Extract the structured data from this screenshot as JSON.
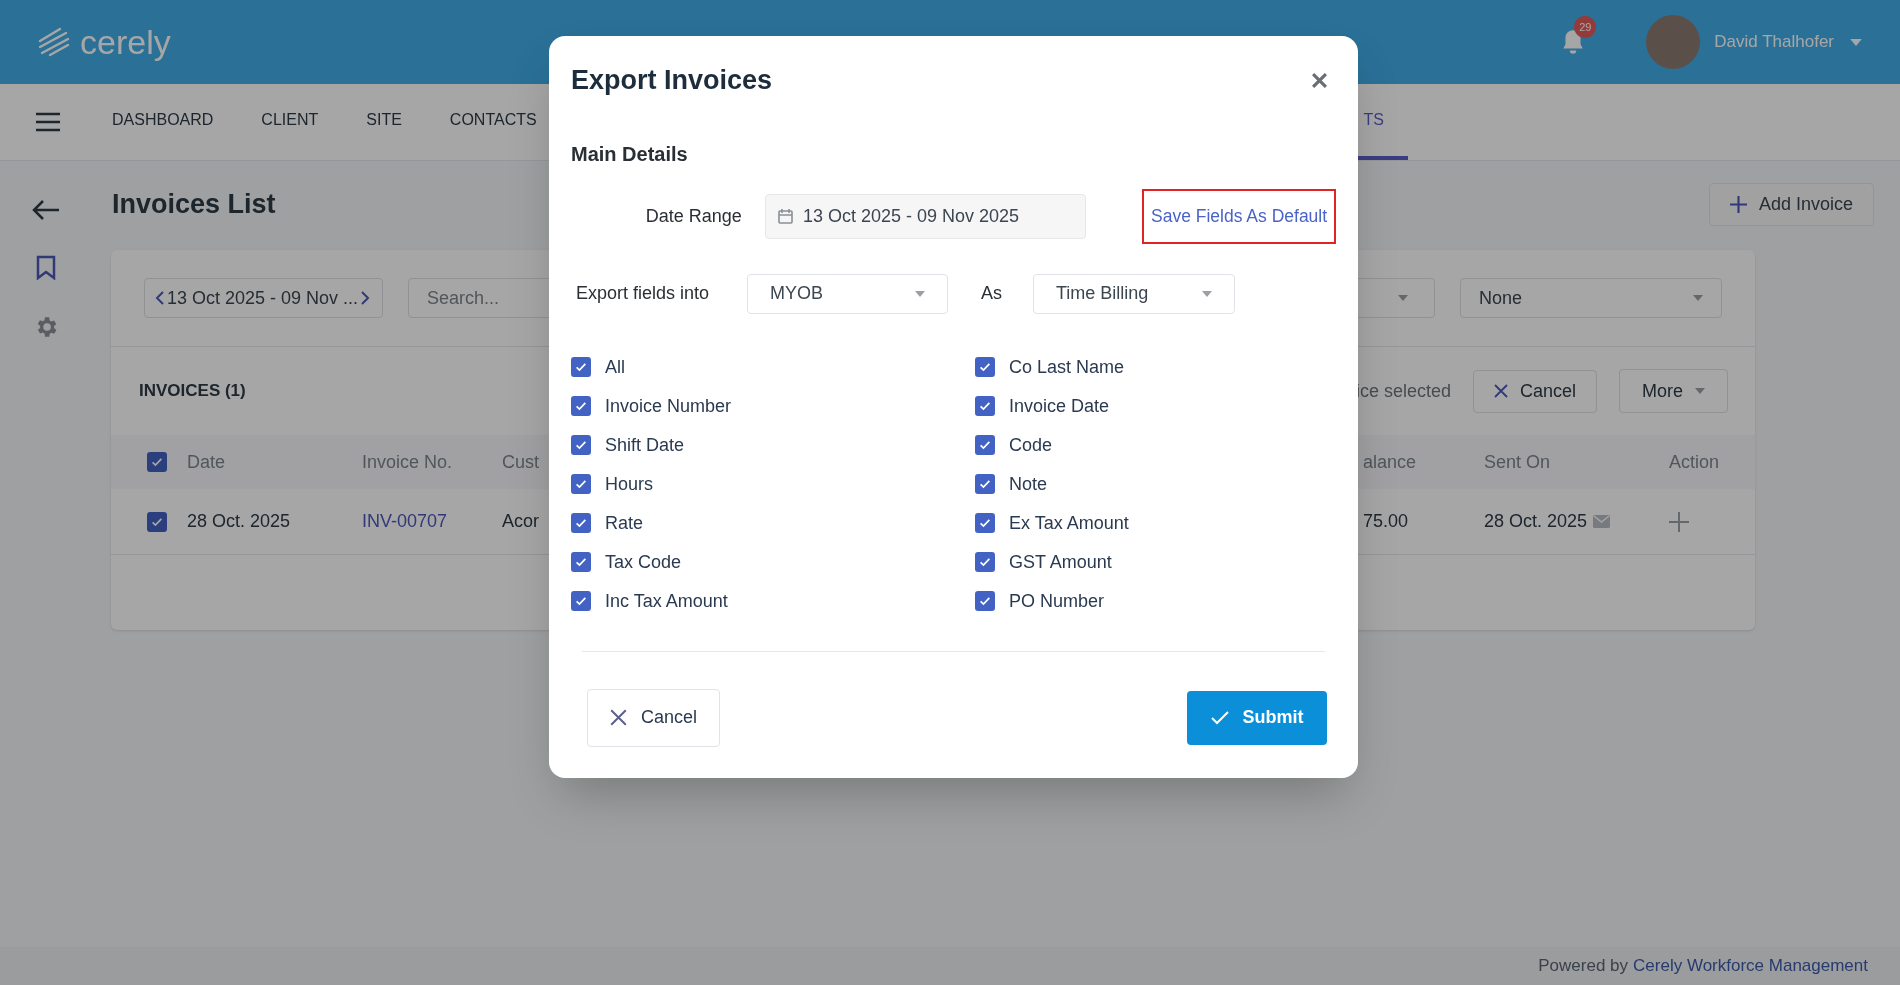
{
  "header": {
    "logo": "cerely",
    "notifications_badge": "29",
    "user_name": "David Thalhofer"
  },
  "nav": {
    "tabs": [
      {
        "label": "DASHBOARD",
        "selected": false
      },
      {
        "label": "CLIENT",
        "selected": false
      },
      {
        "label": "SITE",
        "selected": false
      },
      {
        "label": "CONTACTS",
        "selected": false
      },
      {
        "label": "TS",
        "selected": true
      }
    ]
  },
  "page": {
    "title": "Invoices List",
    "add_button": "Add Invoice"
  },
  "filters": {
    "date_range": "13 Oct 2025 - 09 Nov ...",
    "search_placeholder": "Search...",
    "dropdown_value": "None"
  },
  "list": {
    "heading": "INVOICES (1)",
    "selection_text": "ice selected",
    "cancel_button": "Cancel",
    "more_button": "More"
  },
  "table": {
    "header_checked": true,
    "columns_left": [
      "Date",
      "Invoice No.",
      "Cust"
    ],
    "columns_right": [
      "alance",
      "Sent On",
      "Action"
    ],
    "rows": [
      {
        "checked": true,
        "date": "28 Oct. 2025",
        "invoice_no": "INV-00707",
        "column_3": "Acor",
        "column_4": "75.00",
        "sent_on": "28 Oct. 2025"
      }
    ]
  },
  "footer": {
    "text": "Powered by",
    "link": "Cerely Workforce Management"
  },
  "modal": {
    "title": "Export Invoices",
    "section": "Main Details",
    "date_range_label": "Date Range",
    "date_range": "13 Oct 2025 - 09 Nov 2025",
    "save_default_link": "Save Fields As Default",
    "export_label": "Export fields into",
    "export_target": "MYOB",
    "as_label": "As",
    "export_format": "Time Billing",
    "fields": [
      {
        "label": "All",
        "checked": true
      },
      {
        "label": "Co Last Name",
        "checked": true
      },
      {
        "label": "Invoice Number",
        "checked": true
      },
      {
        "label": "Invoice Date",
        "checked": true
      },
      {
        "label": "Shift Date",
        "checked": true
      },
      {
        "label": "Code",
        "checked": true
      },
      {
        "label": "Hours",
        "checked": true
      },
      {
        "label": "Note",
        "checked": true
      },
      {
        "label": "Rate",
        "checked": true
      },
      {
        "label": "Ex Tax Amount",
        "checked": true
      },
      {
        "label": "Tax Code",
        "checked": true
      },
      {
        "label": "GST Amount",
        "checked": true
      },
      {
        "label": "Inc Tax Amount",
        "checked": true
      },
      {
        "label": "PO Number",
        "checked": true
      }
    ],
    "cancel": "Cancel",
    "submit": "Submit"
  }
}
